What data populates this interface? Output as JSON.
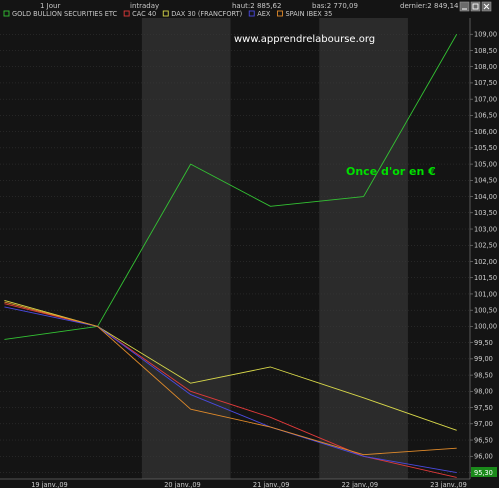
{
  "header": {
    "period": "1 Jour",
    "mode": "intraday",
    "high": "haut:2 885,62",
    "low": "bas:2 770,09",
    "last": "dernier:2 849,14"
  },
  "watermark": "www.apprendrelabourse.org",
  "annotation": "Once d'or en  €",
  "last_value_tag": "95,30",
  "colors": {
    "background": "#141414",
    "band": "#2b2b2b",
    "gold": "#33c233",
    "cac40": "#e23a3a",
    "dax30": "#d8d84a",
    "aex": "#4a4ae0",
    "ibex35": "#e08a2a",
    "annotation": "#00e000",
    "last_tag_bg": "#1a8a1a"
  },
  "chart_data": {
    "type": "line",
    "title": "",
    "xlabel": "",
    "ylabel": "",
    "x": [
      0,
      1,
      2,
      3,
      4,
      5
    ],
    "x_tick_labels": [
      "19 janv.,09",
      "20 janv.,09",
      "21 janv.,09",
      "22 janv.,09",
      "23 janv.,09"
    ],
    "x_tick_positions": [
      0,
      1.5,
      2.5,
      3.5,
      4.5
    ],
    "ylim": [
      95.3,
      109.5
    ],
    "y_ticks": [
      95.5,
      96.0,
      96.5,
      97.0,
      97.5,
      98.0,
      98.5,
      99.0,
      99.5,
      100.0,
      100.5,
      101.0,
      101.5,
      102.0,
      102.5,
      103.0,
      103.5,
      104.0,
      104.5,
      105.0,
      105.5,
      106.0,
      106.5,
      107.0,
      107.5,
      108.0,
      108.5,
      109.0
    ],
    "y_tick_labels": [
      "95,50",
      "96,00",
      "96,50",
      "97,00",
      "97,50",
      "98,00",
      "98,50",
      "99,00",
      "99,50",
      "100,00",
      "100,50",
      "101,00",
      "101,50",
      "102,00",
      "102,50",
      "103,00",
      "103,50",
      "104,00",
      "104,50",
      "105,00",
      "105,50",
      "106,00",
      "106,50",
      "107,00",
      "107,50",
      "108,00",
      "108,50",
      "109,00"
    ],
    "y_axis_side": "right",
    "grid": true,
    "legend_placement": "top",
    "series": [
      {
        "name": "GOLD BULLION SECURITIES ETC",
        "color_key": "gold",
        "x": [
          -0.55,
          0.5,
          1.55,
          2.45,
          3.5,
          4.55
        ],
        "values": [
          99.6,
          100.0,
          105.0,
          103.7,
          104.0,
          109.0
        ]
      },
      {
        "name": "CAC 40",
        "color_key": "cac40",
        "x": [
          -0.55,
          0.5,
          1.55,
          2.45,
          3.5,
          4.55
        ],
        "values": [
          100.7,
          100.0,
          98.0,
          97.2,
          96.0,
          95.35
        ]
      },
      {
        "name": "DAX 30 (FRANCFORT)",
        "color_key": "dax30",
        "x": [
          -0.55,
          0.5,
          1.55,
          2.45,
          3.5,
          4.55
        ],
        "values": [
          100.8,
          100.0,
          98.25,
          98.75,
          97.8,
          96.8
        ]
      },
      {
        "name": "AEX",
        "color_key": "aex",
        "x": [
          -0.55,
          0.5,
          1.55,
          2.45,
          3.5,
          4.55
        ],
        "values": [
          100.6,
          100.0,
          97.9,
          96.9,
          96.0,
          95.5
        ]
      },
      {
        "name": "SPAIN IBEX 35",
        "color_key": "ibex35",
        "x": [
          -0.55,
          0.5,
          1.55,
          2.45,
          3.5,
          4.55
        ],
        "values": [
          100.75,
          100.0,
          97.45,
          96.9,
          96.05,
          96.25
        ]
      }
    ]
  }
}
